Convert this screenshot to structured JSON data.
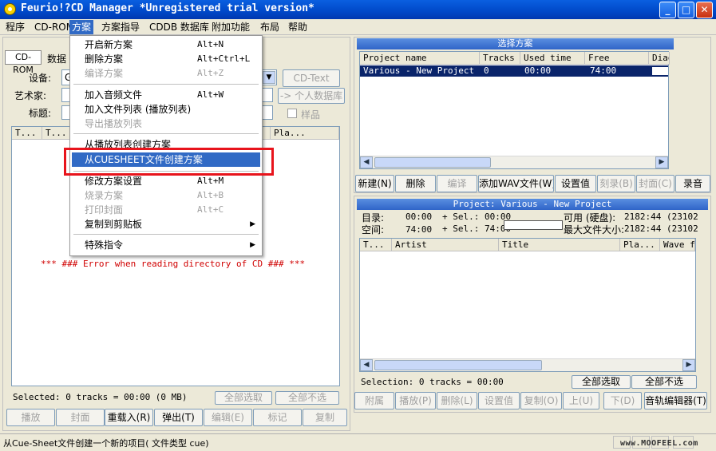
{
  "window": {
    "title": "Feurio!?CD Manager *Unregistered trial version*"
  },
  "menubar": {
    "items": [
      "程序",
      "CD-ROM",
      "方案",
      "方案指导",
      "CDDB 数据库",
      "附加功能",
      "布局",
      "帮助"
    ]
  },
  "menu_fangan": {
    "items": [
      {
        "label": "开启新方案",
        "shortcut": "Alt+N"
      },
      {
        "label": "删除方案",
        "shortcut": "Alt+Ctrl+L"
      },
      {
        "label": "编译方案",
        "shortcut": "Alt+Z"
      },
      {
        "label": "加入音频文件",
        "shortcut": "Alt+W"
      },
      {
        "label": "加入文件列表 (播放列表)",
        "shortcut": ""
      },
      {
        "label": "导出播放列表",
        "shortcut": ""
      },
      {
        "label": "从播放列表创建方案",
        "shortcut": ""
      },
      {
        "label": "从CUESHEET文件创建方案",
        "shortcut": ""
      },
      {
        "label": "修改方案设置",
        "shortcut": "Alt+M"
      },
      {
        "label": "烧录方案",
        "shortcut": "Alt+B"
      },
      {
        "label": "打印封面",
        "shortcut": "Alt+C"
      },
      {
        "label": "复制到剪贴板",
        "shortcut": ""
      },
      {
        "label": "特殊指令",
        "shortcut": ""
      }
    ]
  },
  "left": {
    "tab_cdrom": "CD-ROM",
    "tab_data": "数据",
    "device_label": "设备:",
    "device_value": "G",
    "artist_label": "艺术家:",
    "title_label": "标题:",
    "cdtext_button": "CD-Text",
    "personal_db_button": "-> 个人数据库",
    "sample_label": "样品",
    "columns": [
      "T...",
      "T...",
      "Pla..."
    ],
    "error_message": "*** ### Error when reading directory of CD ### ***",
    "selected_text": "Selected: 0 tracks = 00:00  (0 MB)",
    "select_all": "全部选取",
    "select_none": "全部不选",
    "buttons": [
      "播放",
      "封面",
      "重载入(R)",
      "弹出(T)",
      "编辑(E)",
      "标记",
      "复制"
    ]
  },
  "projects": {
    "header": "选择方案",
    "columns": [
      "Project name",
      "Tracks",
      "Used time",
      "Free",
      "Diag"
    ],
    "rows": [
      [
        "Various - New Project",
        "0",
        "00:00",
        "74:00",
        ""
      ]
    ],
    "buttons": [
      "新建(N)",
      "删除",
      "编译",
      "添加WAV文件(W)",
      "设置值",
      "刻录(B)",
      "封面(C)",
      "录音"
    ]
  },
  "project": {
    "header": "Project: Various - New Project",
    "dir_label": "目录:",
    "dir_value": "00:00",
    "dir_sel": "+ Sel.:   00:00",
    "space_label": "空间:",
    "space_value": "74:00",
    "space_sel": "+ Sel.:  74:00",
    "avail_label": "可用 (硬盘):",
    "avail_value": "2182:44 (23102",
    "maxfile_label": "最大文件大小:",
    "maxfile_value": "2182:44 (23102",
    "columns": [
      "T...",
      "Artist",
      "Title",
      "Pla...",
      "Wave f"
    ],
    "selection_text": "Selection: 0 tracks = 00:00",
    "select_all": "全部选取",
    "select_none": "全部不选",
    "buttons": [
      "附属",
      "播放(P)",
      "删除(L)",
      "设置值",
      "复制(O)",
      "上(U)",
      "下(D)",
      "音轨编辑器(T)"
    ]
  },
  "statusbar": {
    "text": "从Cue-Sheet文件创建一个新的项目( 文件类型 cue)",
    "watermark": "www.MOOFEEL.com"
  },
  "colors": {
    "title_bar": "#0a5fe0",
    "selection": "#316ac5",
    "highlight_box": "#e8141c",
    "error_text": "#d00000",
    "row_selected": "#0a246a"
  }
}
